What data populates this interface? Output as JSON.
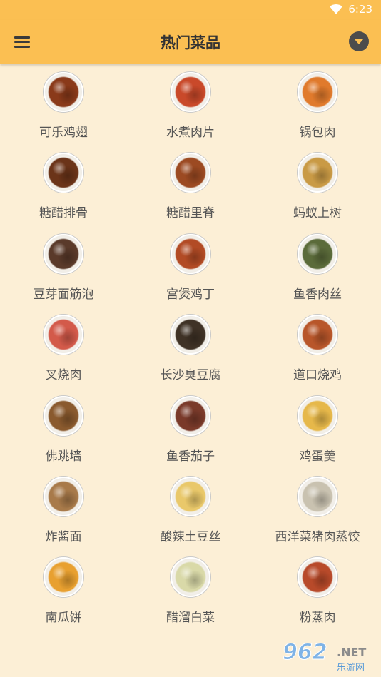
{
  "status_bar": {
    "time": "6:23",
    "icons": [
      "wifi-icon",
      "battery-icon"
    ]
  },
  "app_bar": {
    "title": "热门菜品",
    "menu_icon": "hamburger-menu-icon",
    "dropdown_icon": "chevron-down-icon"
  },
  "colors": {
    "app_bar": "#fbbf52",
    "background": "#fcefd6",
    "text": "#555555",
    "title": "#333333"
  },
  "dishes": [
    {
      "name": "可乐鸡翅",
      "color": "#8a3a1a"
    },
    {
      "name": "水煮肉片",
      "color": "#c9492a"
    },
    {
      "name": "锅包肉",
      "color": "#e07a2c"
    },
    {
      "name": "糖醋排骨",
      "color": "#6b3419"
    },
    {
      "name": "糖醋里脊",
      "color": "#9c4a22"
    },
    {
      "name": "蚂蚁上树",
      "color": "#c99a45"
    },
    {
      "name": "豆芽面筋泡",
      "color": "#5a3a2a"
    },
    {
      "name": "宫煲鸡丁",
      "color": "#b24b25"
    },
    {
      "name": "鱼香肉丝",
      "color": "#5b6b3a"
    },
    {
      "name": "叉烧肉",
      "color": "#d35a4a"
    },
    {
      "name": "长沙臭豆腐",
      "color": "#3f3226"
    },
    {
      "name": "道口烧鸡",
      "color": "#b8562a"
    },
    {
      "name": "佛跳墙",
      "color": "#8a5a2e"
    },
    {
      "name": "鱼香茄子",
      "color": "#7a3a2a"
    },
    {
      "name": "鸡蛋羹",
      "color": "#e6b84a"
    },
    {
      "name": "炸酱面",
      "color": "#a87a4a"
    },
    {
      "name": "酸辣土豆丝",
      "color": "#e9c86a"
    },
    {
      "name": "西洋菜猪肉蒸饺",
      "color": "#c9c2b0"
    },
    {
      "name": "南瓜饼",
      "color": "#e8a030"
    },
    {
      "name": "醋溜白菜",
      "color": "#d9d9a8"
    },
    {
      "name": "粉蒸肉",
      "color": "#b84a2a"
    }
  ],
  "watermark": {
    "number": "962",
    "domain": ".NET",
    "subtitle": "乐游网"
  }
}
